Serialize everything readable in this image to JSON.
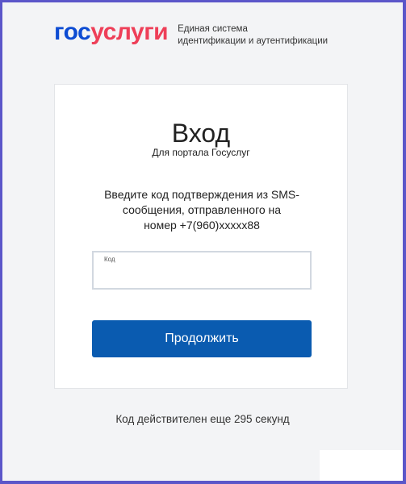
{
  "header": {
    "logo_part1": "гос",
    "logo_part2": "услуги",
    "tagline_line1": "Единая система",
    "tagline_line2": "идентификации и аутентификации"
  },
  "card": {
    "title": "Вход",
    "subtitle": "Для портала Госуслуг",
    "message_line1": "Введите код подтверждения из SMS-",
    "message_line2": "сообщения, отправленного на",
    "message_line3": "номер +7(960)xxxxx88",
    "code_label": "Код",
    "code_value": "",
    "continue_label": "Продолжить"
  },
  "footer": {
    "timer_text": "Код действителен еще 295 секунд"
  },
  "colors": {
    "brand_blue": "#0d4cd3",
    "brand_red": "#ee3f58",
    "button_blue": "#0a5bb0",
    "frame": "#5b56c9"
  }
}
